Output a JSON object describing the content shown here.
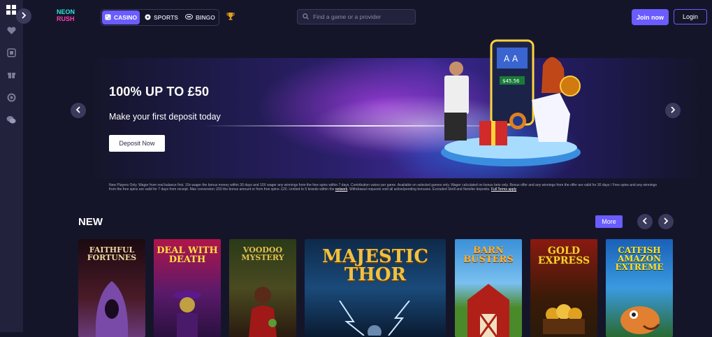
{
  "sidebar": {
    "items": [
      {
        "name": "grid-icon"
      },
      {
        "name": "heart-icon"
      },
      {
        "name": "casino-chip-icon"
      },
      {
        "name": "gift-icon"
      },
      {
        "name": "lifebuoy-icon"
      },
      {
        "name": "chat-icon"
      }
    ],
    "expand_icon": "chevron-right-icon"
  },
  "header": {
    "logo": {
      "line1": "NEON",
      "line2": "RUSH"
    },
    "tabs": [
      {
        "label": "CASINO",
        "icon": "dice-icon",
        "active": true
      },
      {
        "label": "SPORTS",
        "icon": "football-icon",
        "active": false
      },
      {
        "label": "BINGO",
        "icon": "bingo-icon",
        "active": false
      }
    ],
    "search": {
      "placeholder": "Find a game or a provider",
      "value": ""
    },
    "join_label": "Join now",
    "login_label": "Login"
  },
  "hero": {
    "title": "100% UP TO £50",
    "subtitle": "Make your first deposit today",
    "cta_label": "Deposit Now",
    "terms_text": "New Players Only. Wager from real balance first. 10x wager the bonus money within 30 days and 10X wager any winnings from the free spins within 7 days. Contribution varies per game. Available on selected games only. Wager calculated on bonus bets only. Bonus offer and any winnings from the offer are valid for 30 days / Free spins and any winnings from the free spins are valid for 7 days from receipt. Max conversion: £50 the bonus amount or from free spins: £20. Limited to 5 brands within the",
    "terms_link": "network",
    "terms_text2": ". Withdrawal requests void all active/pending bonuses. Excluded Skrill and Neteller deposits.",
    "terms_link2": "Full Terms apply",
    "slot_win": "$45.56"
  },
  "new_section": {
    "title": "NEW",
    "more_label": "More",
    "games": [
      {
        "title": "FAITHFUL FORTUNES",
        "bg": "#2a0f14"
      },
      {
        "title": "DEAL WITH DEATH",
        "bg": "#3a1552"
      },
      {
        "title": "VOODOO MYSTERY",
        "bg": "#1a2a10"
      },
      {
        "title": "MAJESTIC THOR",
        "bg": "#16365a"
      },
      {
        "title": "BARN BUSTERS",
        "bg": "#2a7ac0"
      },
      {
        "title": "GOLD EXPRESS",
        "bg": "#5a1a10"
      },
      {
        "title": "CATFISH AMAZON EXTREME",
        "bg": "#1a5aa8"
      }
    ]
  },
  "colors": {
    "accent": "#6a5cff",
    "background": "#15152a",
    "sidebar": "#22223c"
  }
}
